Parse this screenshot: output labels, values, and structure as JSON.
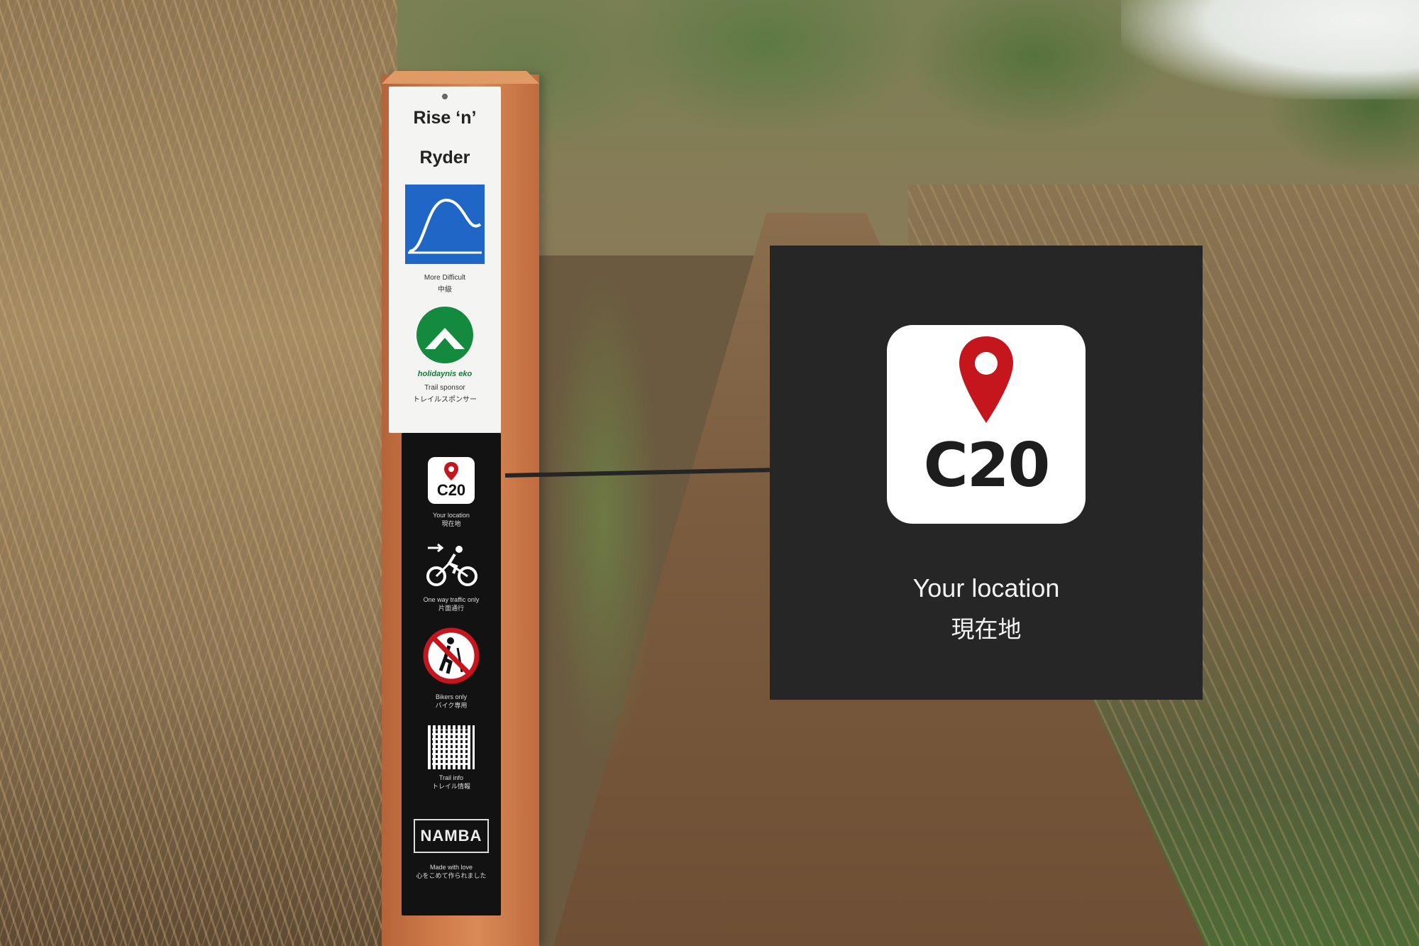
{
  "sign": {
    "trail_name_line1": "Rise ‘n’",
    "trail_name_line2": "Ryder",
    "difficulty_en": "More Difficult",
    "difficulty_jp": "中級",
    "sponsor_logo_text": "holidaynis eko",
    "sponsor_en": "Trail sponsor",
    "sponsor_jp": "トレイルスポンサー",
    "location_code": "C20",
    "location_en": "Your location",
    "location_jp": "現在地",
    "oneway_en": "One way traffic only",
    "oneway_jp": "片面通行",
    "bikers_en": "Bikers only",
    "bikers_jp": "バイク専用",
    "info_en": "Trail info",
    "info_jp": "トレイル情報",
    "club_logo": "NAMBA",
    "made_en": "Made with love",
    "made_jp": "心をこめて作られました"
  },
  "callout": {
    "code": "C20",
    "label_en": "Your location",
    "label_jp": "現在地",
    "icon": "location-pin-icon"
  },
  "colors": {
    "difficulty_blue": "#1f66c6",
    "pin_red": "#c4161c",
    "sponsor_green": "#137a3a",
    "callout_bg": "#262626"
  }
}
